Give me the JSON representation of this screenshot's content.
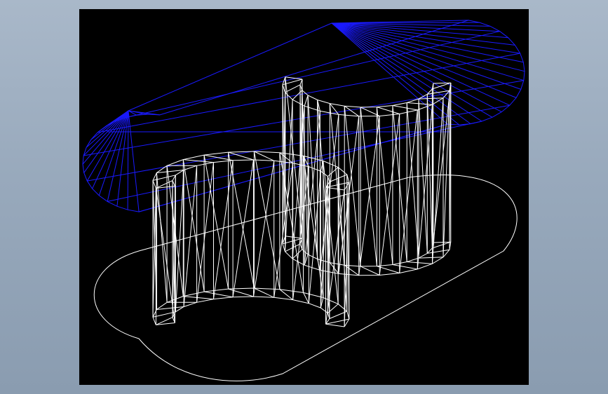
{
  "viewport": {
    "background": "#000000",
    "frame_background": "#9aabbe"
  },
  "colors": {
    "body_wire": "#ffffff",
    "cap_wire": "#1a1aff",
    "base_outline": "#ffffff"
  },
  "model": {
    "shapes": [
      "base-obround-outline",
      "top-obround-cap-wireframe",
      "left-semi-cylinder-wireframe",
      "right-semi-cylinder-wireframe"
    ]
  }
}
